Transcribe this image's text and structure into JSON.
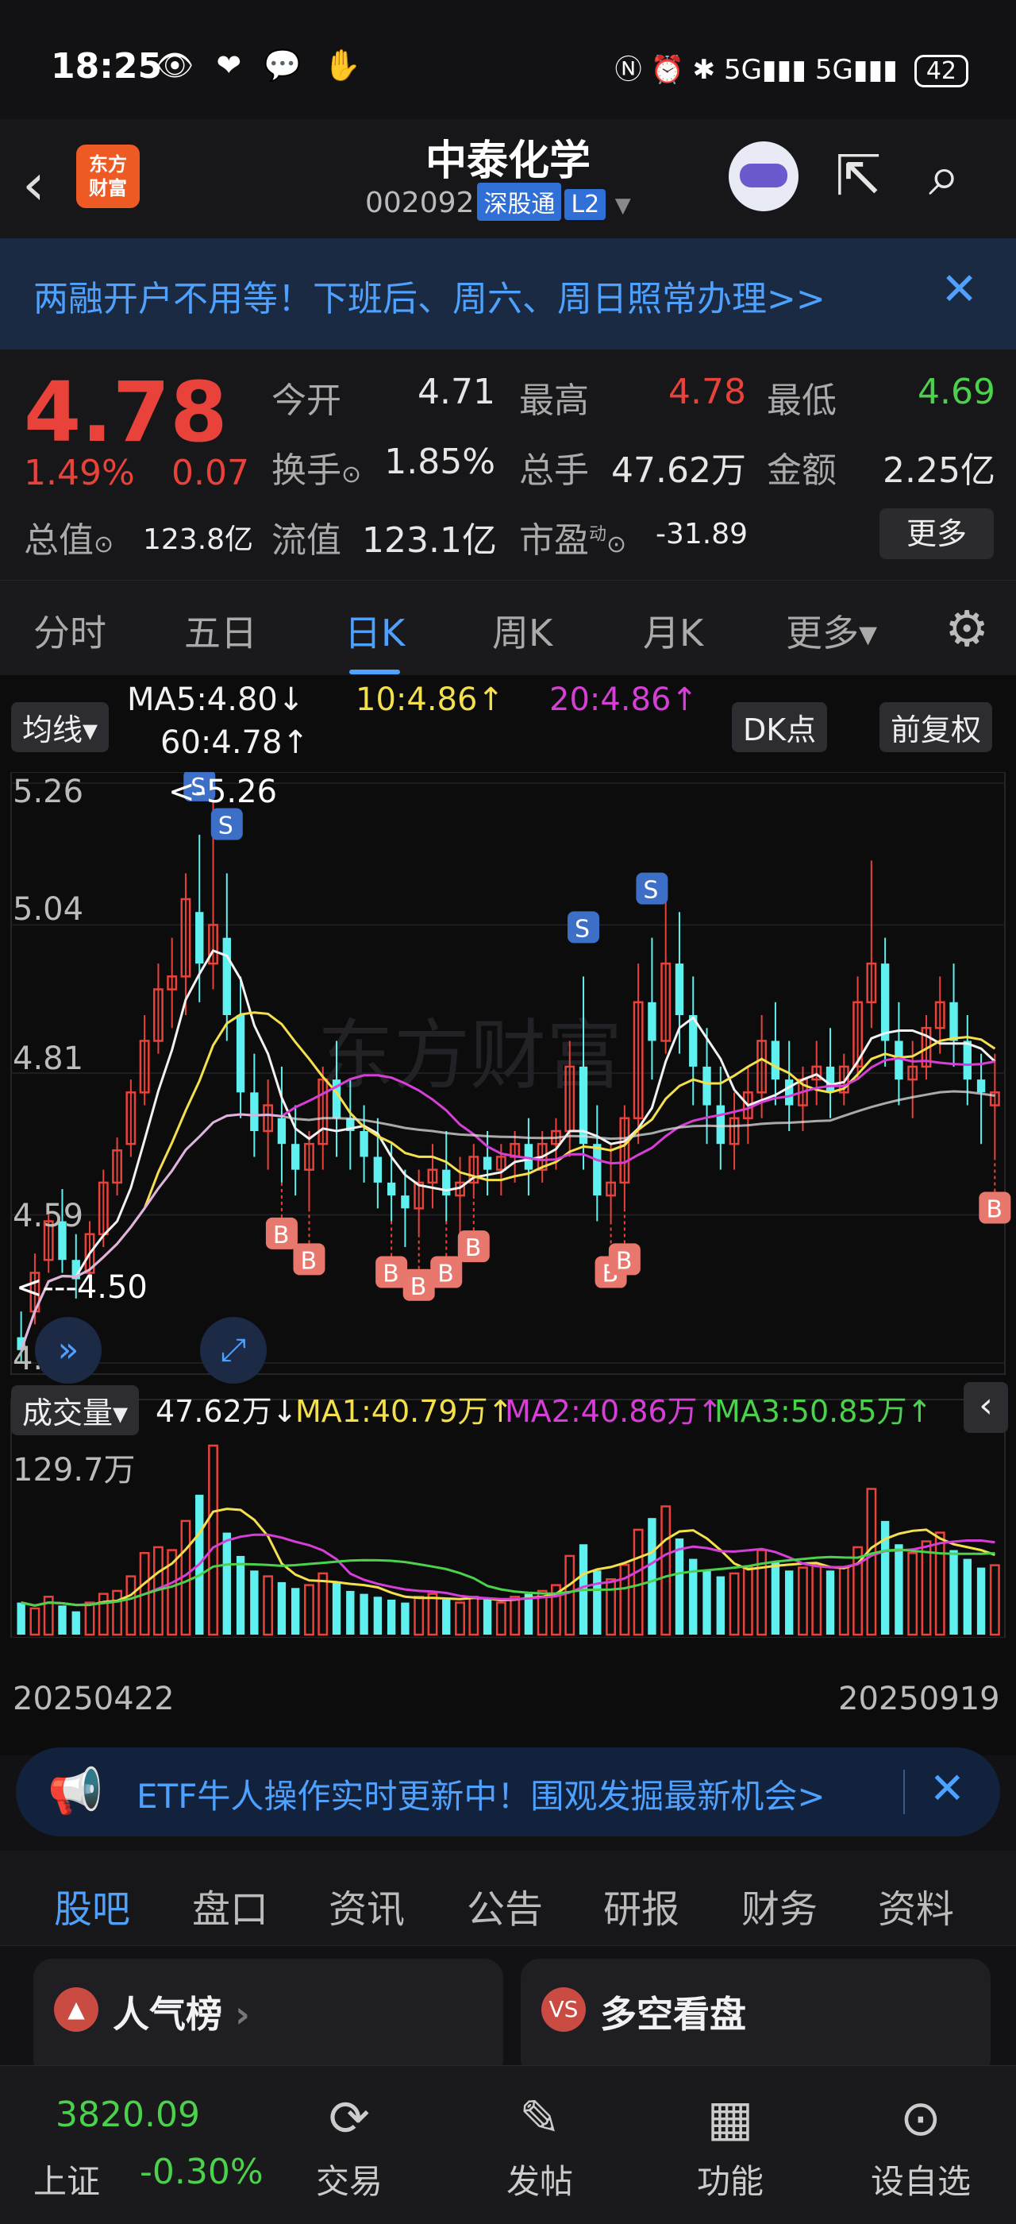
{
  "status_bar": {
    "time": "18:25",
    "signal_1": "5G",
    "signal_2": "5G",
    "battery": "42"
  },
  "header": {
    "back_icon": "chevron-left-icon",
    "logo_text": "东方\n财富",
    "stock_name": "中泰化学",
    "stock_code": "002092",
    "tag_connect": "深股通",
    "tag_level": "L2",
    "share_icon": "share-icon",
    "search_icon": "search-icon"
  },
  "banner": {
    "text": "两融开户不用等！下班后、周六、周日照常办理>>"
  },
  "quote": {
    "price": "4.78",
    "pct": "1.49%",
    "change": "0.07",
    "fields": [
      {
        "label": "今开",
        "value": "4.71",
        "color": "#f2f2f2"
      },
      {
        "label": "最高",
        "value": "4.78",
        "color": "#e8423a"
      },
      {
        "label": "最低",
        "value": "4.69",
        "color": "#4bd14b"
      },
      {
        "label": "换手",
        "value": "1.85%",
        "color": "#f2f2f2"
      },
      {
        "label": "总手",
        "value": "47.62万",
        "color": "#f2f2f2"
      },
      {
        "label": "金额",
        "value": "2.25亿",
        "color": "#f2f2f2"
      }
    ],
    "total_value_label": "总值",
    "total_value": "123.8亿",
    "float_value_label": "流值",
    "float_value": "123.1亿",
    "pe_label": "市盈",
    "pe_sup": "动",
    "pe_value": "-31.89",
    "more_label": "更多"
  },
  "chart_tabs": {
    "items": [
      "分时",
      "五日",
      "日K",
      "周K",
      "月K",
      "更多▾"
    ],
    "active": 2
  },
  "kline": {
    "ma_selector": "均线▾",
    "ma5": "MA5:4.80↓",
    "ma10": "10:4.86↑",
    "ma20": "20:4.86↑",
    "ma60": "60:4.78↑",
    "dk_label": "DK点",
    "adjust_label": "前复权",
    "max_marker": "<-5.26",
    "min_marker": "<---4.50",
    "watermark": "东方财富"
  },
  "volume": {
    "selector": "成交量▾",
    "vol": "47.62万↓",
    "ma1": "MA1:40.79万↑",
    "ma2": "MA2:40.86万↑",
    "ma3": "MA3:50.85万↑",
    "max_label": "129.7万",
    "start_date": "20250422",
    "end_date": "20250919"
  },
  "chart_data": {
    "type": "candlestick",
    "ylim": [
      4.36,
      5.26
    ],
    "y_ticks": [
      "5.26",
      "5.04",
      "4.81",
      "4.59",
      "4.36"
    ],
    "ohlc": [
      [
        4.4,
        4.44,
        4.38,
        4.36
      ],
      [
        4.44,
        4.53,
        4.5,
        4.42
      ],
      [
        4.52,
        4.6,
        4.58,
        4.5
      ],
      [
        4.58,
        4.63,
        4.52,
        4.5
      ],
      [
        4.52,
        4.56,
        4.49,
        4.46
      ],
      [
        4.5,
        4.58,
        4.56,
        4.48
      ],
      [
        4.56,
        4.66,
        4.64,
        4.54
      ],
      [
        4.64,
        4.71,
        4.69,
        4.62
      ],
      [
        4.7,
        4.8,
        4.78,
        4.68
      ],
      [
        4.78,
        4.9,
        4.86,
        4.76
      ],
      [
        4.86,
        4.98,
        4.94,
        4.84
      ],
      [
        4.94,
        5.02,
        4.96,
        4.88
      ],
      [
        4.96,
        5.12,
        5.08,
        4.9
      ],
      [
        5.06,
        5.18,
        4.98,
        4.92
      ],
      [
        4.98,
        5.26,
        5.04,
        4.94
      ],
      [
        5.02,
        5.12,
        4.9,
        4.86
      ],
      [
        4.9,
        4.96,
        4.78,
        4.74
      ],
      [
        4.78,
        4.84,
        4.72,
        4.68
      ],
      [
        4.72,
        4.8,
        4.76,
        4.66
      ],
      [
        4.74,
        4.82,
        4.7,
        4.64
      ],
      [
        4.7,
        4.76,
        4.66,
        4.62
      ],
      [
        4.66,
        4.72,
        4.7,
        4.6
      ],
      [
        4.7,
        4.82,
        4.8,
        4.66
      ],
      [
        4.8,
        4.86,
        4.74,
        4.68
      ],
      [
        4.74,
        4.8,
        4.72,
        4.66
      ],
      [
        4.72,
        4.76,
        4.68,
        4.64
      ],
      [
        4.68,
        4.74,
        4.64,
        4.6
      ],
      [
        4.64,
        4.7,
        4.62,
        4.58
      ],
      [
        4.62,
        4.66,
        4.6,
        4.54
      ],
      [
        4.6,
        4.66,
        4.64,
        4.56
      ],
      [
        4.64,
        4.7,
        4.66,
        4.6
      ],
      [
        4.66,
        4.72,
        4.62,
        4.58
      ],
      [
        4.62,
        4.68,
        4.64,
        4.56
      ],
      [
        4.64,
        4.7,
        4.68,
        4.62
      ],
      [
        4.68,
        4.72,
        4.66,
        4.62
      ],
      [
        4.66,
        4.7,
        4.68,
        4.62
      ],
      [
        4.68,
        4.72,
        4.7,
        4.64
      ],
      [
        4.7,
        4.74,
        4.66,
        4.62
      ],
      [
        4.66,
        4.72,
        4.7,
        4.64
      ],
      [
        4.7,
        4.74,
        4.72,
        4.66
      ],
      [
        4.72,
        4.86,
        4.82,
        4.68
      ],
      [
        4.82,
        4.96,
        4.7,
        4.66
      ],
      [
        4.7,
        4.76,
        4.62,
        4.58
      ],
      [
        4.62,
        4.7,
        4.64,
        4.58
      ],
      [
        4.64,
        4.76,
        4.74,
        4.6
      ],
      [
        4.74,
        4.98,
        4.92,
        4.7
      ],
      [
        4.92,
        5.02,
        4.86,
        4.8
      ],
      [
        4.86,
        5.08,
        4.98,
        4.84
      ],
      [
        4.98,
        5.06,
        4.9,
        4.84
      ],
      [
        4.9,
        4.96,
        4.82,
        4.76
      ],
      [
        4.82,
        4.88,
        4.76,
        4.7
      ],
      [
        4.76,
        4.82,
        4.7,
        4.66
      ],
      [
        4.7,
        4.78,
        4.74,
        4.66
      ],
      [
        4.74,
        4.82,
        4.78,
        4.7
      ],
      [
        4.78,
        4.9,
        4.86,
        4.74
      ],
      [
        4.86,
        4.92,
        4.8,
        4.76
      ],
      [
        4.8,
        4.86,
        4.76,
        4.72
      ],
      [
        4.76,
        4.82,
        4.8,
        4.72
      ],
      [
        4.8,
        4.86,
        4.82,
        4.76
      ],
      [
        4.82,
        4.88,
        4.78,
        4.74
      ],
      [
        4.78,
        4.84,
        4.82,
        4.76
      ],
      [
        4.82,
        4.96,
        4.92,
        4.8
      ],
      [
        4.92,
        5.14,
        4.98,
        4.88
      ],
      [
        4.98,
        5.02,
        4.86,
        4.82
      ],
      [
        4.86,
        4.92,
        4.8,
        4.76
      ],
      [
        4.8,
        4.86,
        4.82,
        4.74
      ],
      [
        4.82,
        4.9,
        4.88,
        4.8
      ],
      [
        4.88,
        4.96,
        4.92,
        4.84
      ],
      [
        4.92,
        4.98,
        4.86,
        4.82
      ],
      [
        4.86,
        4.9,
        4.8,
        4.76
      ],
      [
        4.8,
        4.84,
        4.78,
        4.7
      ],
      [
        4.76,
        4.84,
        4.78,
        4.68
      ]
    ],
    "volumes": [
      22,
      18,
      26,
      20,
      16,
      22,
      28,
      30,
      40,
      56,
      60,
      58,
      78,
      96,
      129.7,
      70,
      54,
      44,
      40,
      36,
      32,
      34,
      42,
      36,
      30,
      28,
      26,
      24,
      22,
      26,
      28,
      24,
      22,
      26,
      24,
      22,
      26,
      28,
      30,
      34,
      54,
      62,
      44,
      38,
      48,
      72,
      80,
      88,
      66,
      52,
      44,
      40,
      42,
      46,
      58,
      50,
      44,
      46,
      48,
      44,
      46,
      60,
      100,
      78,
      62,
      56,
      64,
      70,
      58,
      52,
      46,
      47.62
    ]
  },
  "ad": {
    "text": "ETF牛人操作实时更新中！围观发掘最新机会>"
  },
  "sub_tabs": {
    "items": [
      "股吧",
      "盘口",
      "资讯",
      "公告",
      "研报",
      "财务",
      "资料"
    ],
    "active": 0
  },
  "cards": [
    {
      "title": "人气榜",
      "icon": "fire-icon"
    },
    {
      "title": "多空看盘",
      "icon": "vs-icon"
    }
  ],
  "bottom_bar": {
    "index_value": "3820.09",
    "index_name": "上证",
    "index_pct": "-0.30%",
    "items": [
      {
        "label": "交易",
        "icon": "yuan-icon"
      },
      {
        "label": "发帖",
        "icon": "edit-icon"
      },
      {
        "label": "功能",
        "icon": "grid-icon"
      },
      {
        "label": "设自选",
        "icon": "more-icon"
      }
    ]
  }
}
